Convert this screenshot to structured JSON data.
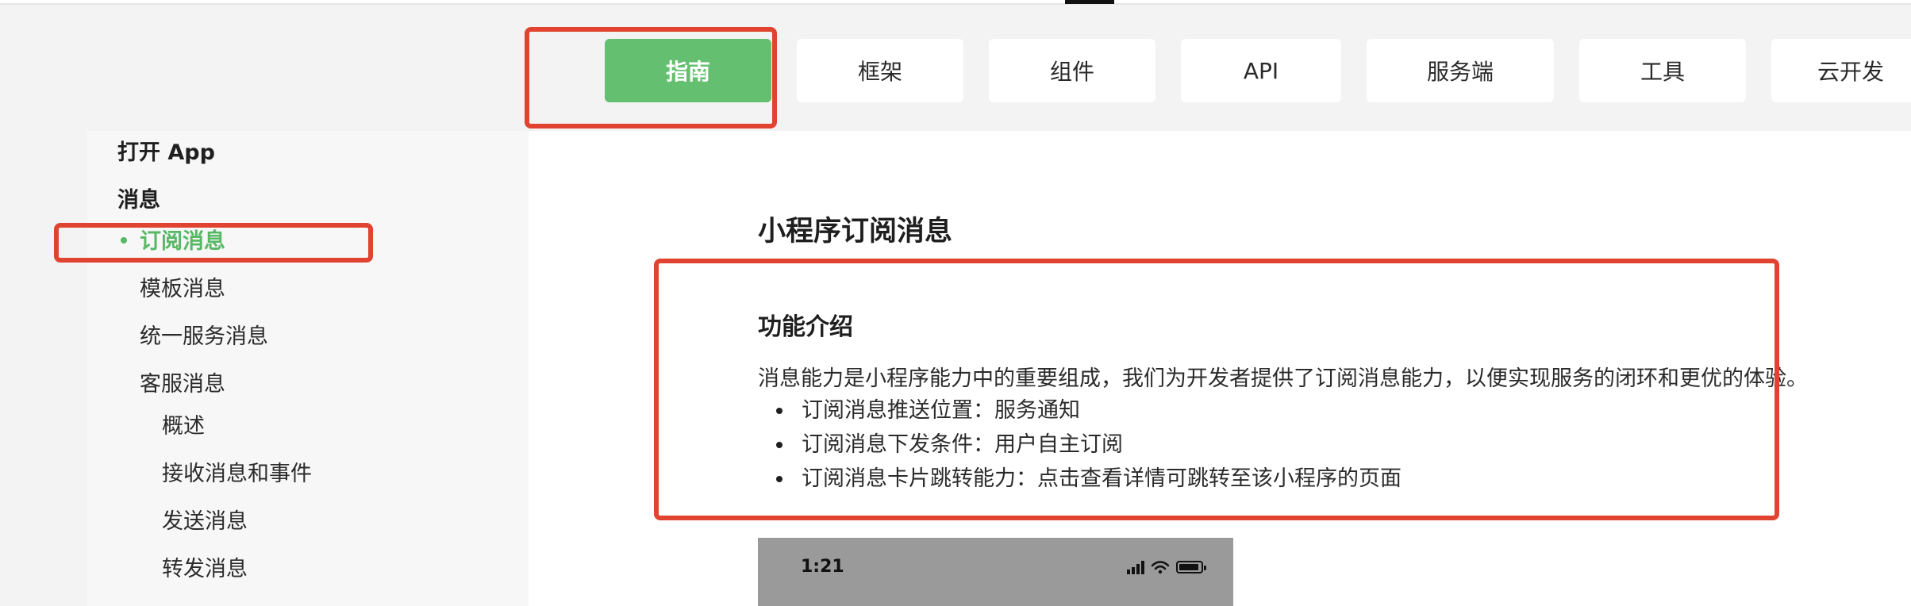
{
  "header": {
    "tabs": [
      {
        "label": "指南",
        "active": true
      },
      {
        "label": "框架",
        "active": false
      },
      {
        "label": "组件",
        "active": false
      },
      {
        "label": "API",
        "active": false
      },
      {
        "label": "服务端",
        "active": false
      },
      {
        "label": "工具",
        "active": false
      },
      {
        "label": "云开发",
        "active": false
      }
    ]
  },
  "sidebar": {
    "items": [
      {
        "label": "打开 App",
        "level": "group"
      },
      {
        "label": "消息",
        "level": "group"
      },
      {
        "label": "订阅消息",
        "level": "child",
        "active": true
      },
      {
        "label": "模板消息",
        "level": "child"
      },
      {
        "label": "统一服务消息",
        "level": "child"
      },
      {
        "label": "客服消息",
        "level": "child"
      },
      {
        "label": "概述",
        "level": "grandchild"
      },
      {
        "label": "接收消息和事件",
        "level": "grandchild"
      },
      {
        "label": "发送消息",
        "level": "grandchild"
      },
      {
        "label": "转发消息",
        "level": "grandchild"
      }
    ]
  },
  "content": {
    "page_title": "小程序订阅消息",
    "section_title": "功能介绍",
    "intro": "消息能力是小程序能力中的重要组成，我们为开发者提供了订阅消息能力，以便实现服务的闭环和更优的体验。",
    "features": [
      "订阅消息推送位置：服务通知",
      "订阅消息下发条件：用户自主订阅",
      "订阅消息卡片跳转能力：点击查看详情可跳转至该小程序的页面"
    ]
  },
  "preview": {
    "time": "1:21"
  },
  "colors": {
    "accent": "#64bf70",
    "annotation": "#e04431"
  },
  "icons": [
    "signal-icon",
    "wifi-icon",
    "battery-icon"
  ]
}
